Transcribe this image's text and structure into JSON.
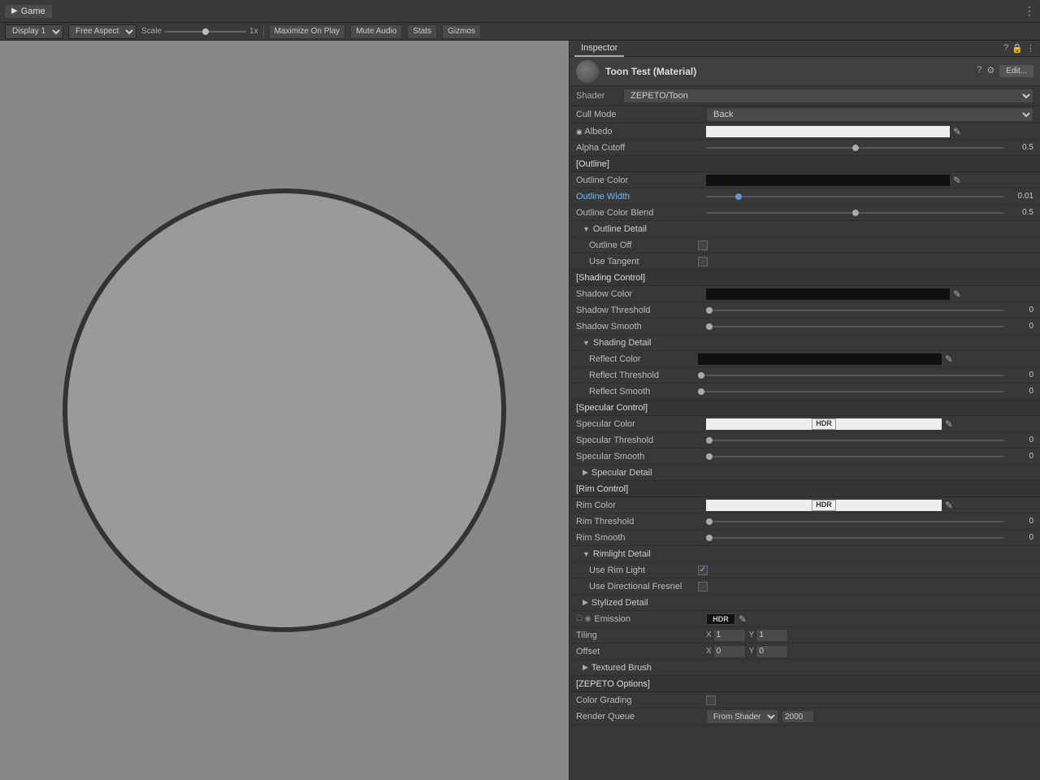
{
  "topbar": {
    "game_icon": "▶",
    "game_label": "Game",
    "dots": "⋮"
  },
  "toolbar": {
    "display_label": "Display 1",
    "aspect_label": "Free Aspect",
    "scale_label": "Scale",
    "scale_value": "1x",
    "maximize_label": "Maximize On Play",
    "mute_label": "Mute Audio",
    "stats_label": "Stats",
    "gizmos_label": "Gizmos"
  },
  "inspector": {
    "tab_label": "Inspector",
    "material_name": "Toon Test (Material)",
    "shader_label": "Shader",
    "shader_value": "ZEPETO/Toon",
    "edit_label": "Edit...",
    "cull_mode_label": "Cull Mode",
    "cull_mode_value": "Back",
    "albedo_label": "Albedo",
    "alpha_cutoff_label": "Alpha Cutoff",
    "alpha_cutoff_value": "0.5",
    "outline_section": "[Outline]",
    "outline_color_label": "Outline Color",
    "outline_width_label": "Outline Width",
    "outline_width_value": "0.01",
    "outline_color_blend_label": "Outline Color Blend",
    "outline_color_blend_value": "0.5",
    "outline_detail_label": "Outline Detail",
    "outline_off_label": "Outline Off",
    "use_tangent_label": "Use Tangent",
    "shading_section": "[Shading Control]",
    "shadow_color_label": "Shadow Color",
    "shadow_threshold_label": "Shadow Threshold",
    "shadow_threshold_value": "0",
    "shadow_smooth_label": "Shadow Smooth",
    "shadow_smooth_value": "0",
    "shading_detail_label": "Shading Detail",
    "reflect_color_label": "Reflect Color",
    "reflect_threshold_label": "Reflect Threshold",
    "reflect_threshold_value": "0",
    "reflect_smooth_label": "Reflect Smooth",
    "reflect_smooth_value": "0",
    "specular_section": "[Specular Control]",
    "specular_color_label": "Specular Color",
    "specular_threshold_label": "Specular Threshold",
    "specular_threshold_value": "0",
    "specular_smooth_label": "Specular Smooth",
    "specular_smooth_value": "0",
    "specular_detail_label": "Specular Detail",
    "rim_section": "[Rim Control]",
    "rim_color_label": "Rim Color",
    "rim_threshold_label": "Rim Threshold",
    "rim_threshold_value": "0",
    "rim_smooth_label": "Rim Smooth",
    "rim_smooth_value": "0",
    "rimlight_detail_label": "Rimlight Detail",
    "use_rim_light_label": "Use Rim Light",
    "use_directional_fresnel_label": "Use Directional Fresnel",
    "stylized_detail_label": "Stylized Detail",
    "emission_label": "Emission",
    "tiling_label": "Tiling",
    "tiling_x": "1",
    "tiling_y": "1",
    "offset_label": "Offset",
    "offset_x": "0",
    "offset_y": "0",
    "textured_brush_label": "Textured Brush",
    "zepeto_options_label": "[ZEPETO Options]",
    "color_grading_label": "Color Grading",
    "render_queue_label": "Render Queue",
    "render_queue_value": "2000",
    "from_shader_label": "From Shader"
  }
}
